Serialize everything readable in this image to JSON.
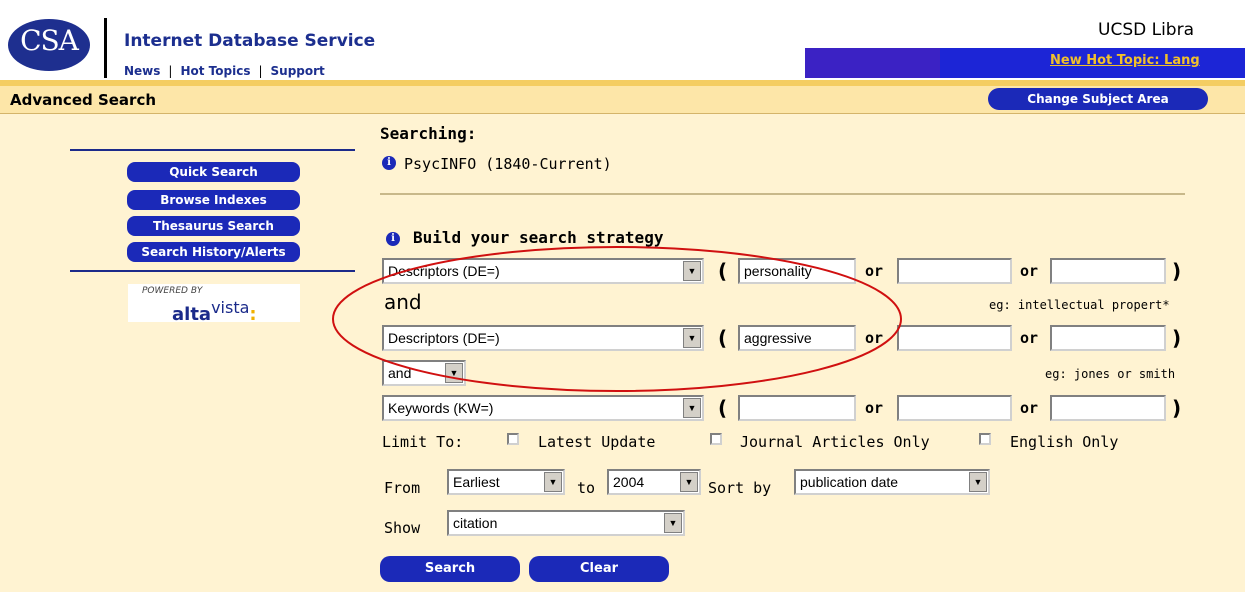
{
  "header": {
    "logo_text": "CSA",
    "site_title": "Internet Database Service",
    "nav": [
      "News",
      "Hot Topics",
      "Support"
    ],
    "library_name": "UCSD Libra",
    "hot_topic_link": "New Hot Topic: Lang"
  },
  "titlebar": {
    "page_title": "Advanced Search",
    "change_subject_label": "Change Subject Area"
  },
  "sidebar": {
    "buttons": [
      "Quick Search",
      "Browse Indexes",
      "Thesaurus Search",
      "Search History/Alerts"
    ],
    "powered_by": "POWERED BY",
    "alta": "alta",
    "vista": "vista",
    "colon": ":"
  },
  "searching": {
    "label": "Searching:",
    "database": "PsycINFO (1840-Current)"
  },
  "strategy": {
    "title": "Build your search strategy",
    "rows": [
      {
        "field": "Descriptors (DE=)",
        "term1": "personality",
        "term2": "",
        "term3": ""
      },
      {
        "field": "Descriptors (DE=)",
        "term1": "aggressive",
        "term2": "",
        "term3": ""
      },
      {
        "field": "Keywords (KW=)",
        "term1": "",
        "term2": "",
        "term3": ""
      }
    ],
    "connector1": "and",
    "connector2": "and",
    "open_paren": "(",
    "close_paren": ")",
    "or": "or",
    "hint1": "eg: intellectual propert*",
    "hint2": "eg: jones or smith"
  },
  "limits": {
    "label": "Limit To:",
    "options": [
      "Latest Update",
      "Journal Articles Only",
      "English Only"
    ]
  },
  "range": {
    "from_label": "From",
    "from_value": "Earliest",
    "to_label": "to",
    "to_value": "2004",
    "sort_label": "Sort by",
    "sort_value": "publication date"
  },
  "show": {
    "label": "Show",
    "value": "citation"
  },
  "buttons": {
    "search": "Search",
    "clear": "Clear"
  },
  "colors": {
    "accent_blue": "#1b29b8",
    "panel_bg": "#fff3d2",
    "annotation_red": "#d01010"
  }
}
